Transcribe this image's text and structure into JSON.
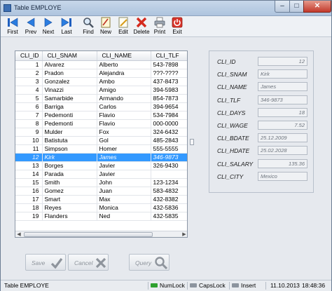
{
  "window": {
    "title": "Table EMPLOYE",
    "close_glyph": "✕",
    "min_glyph": "–",
    "max_glyph": "□"
  },
  "toolbar": [
    {
      "label": "First",
      "icon": "first-icon"
    },
    {
      "label": "Prev",
      "icon": "prev-icon"
    },
    {
      "label": "Next",
      "icon": "next-icon"
    },
    {
      "label": "Last",
      "icon": "last-icon"
    },
    {
      "label": "Find",
      "icon": "find-icon"
    },
    {
      "label": "New",
      "icon": "new-icon"
    },
    {
      "label": "Edit",
      "icon": "edit-icon"
    },
    {
      "label": "Delete",
      "icon": "delete-icon"
    },
    {
      "label": "Print",
      "icon": "print-icon"
    },
    {
      "label": "Exit",
      "icon": "exit-icon"
    }
  ],
  "grid": {
    "columns": [
      "CLI_ID",
      "CLI_SNAM",
      "CLI_NAME",
      "CLI_TLF"
    ],
    "selected_index": 11,
    "rows": [
      [
        "1",
        "Alvarez",
        "Alberto",
        "543-7898"
      ],
      [
        "2",
        "Pradon",
        "Alejandra",
        "???-????"
      ],
      [
        "3",
        "Gonzalez",
        "Ambo",
        "437-8473"
      ],
      [
        "4",
        "Vinazzi",
        "Amigo",
        "394-5983"
      ],
      [
        "5",
        "Samarbide",
        "Armando",
        "854-7873"
      ],
      [
        "6",
        "Barriga",
        "Carlos",
        "394-9654"
      ],
      [
        "7",
        "Pedemonti",
        "Flavio",
        "534-7984"
      ],
      [
        "8",
        "Pedemonti",
        "Flavio",
        "000-0000"
      ],
      [
        "9",
        "Mulder",
        "Fox",
        "324-6432"
      ],
      [
        "10",
        "Batistuta",
        "Gol",
        "485-2843"
      ],
      [
        "11",
        "Simpson",
        "Homer",
        "555-5555"
      ],
      [
        "12",
        "Kirk",
        "James",
        "346-9873"
      ],
      [
        "13",
        "Borges",
        "Javier",
        "326-9430"
      ],
      [
        "14",
        "Parada",
        "Javier",
        ""
      ],
      [
        "15",
        "Smith",
        "John",
        "123-1234"
      ],
      [
        "16",
        "Gomez",
        "Juan",
        "583-4832"
      ],
      [
        "17",
        "Smart",
        "Max",
        "432-8382"
      ],
      [
        "18",
        "Reyes",
        "Monica",
        "432-5836"
      ],
      [
        "19",
        "Flanders",
        "Ned",
        "432-5835"
      ]
    ]
  },
  "detail": [
    {
      "label": "CLI_ID",
      "value": "12",
      "align": "right"
    },
    {
      "label": "CLI_SNAM",
      "value": "Kirk",
      "align": "left"
    },
    {
      "label": "CLI_NAME",
      "value": "James",
      "align": "left"
    },
    {
      "label": "CLI_TLF",
      "value": "346-9873",
      "align": "left"
    },
    {
      "label": "CLI_DAYS",
      "value": "18",
      "align": "right"
    },
    {
      "label": "CLI_WAGE",
      "value": "7.52",
      "align": "right"
    },
    {
      "label": "CLI_BDATE",
      "value": "25.12.2009",
      "align": "left"
    },
    {
      "label": "CLI_HDATE",
      "value": "25.02.2028",
      "align": "left"
    },
    {
      "label": "CLI_SALARY",
      "value": "135.36",
      "align": "right"
    },
    {
      "label": "CLI_CITY",
      "value": "Mexico",
      "align": "left"
    }
  ],
  "buttons": {
    "save": "Save",
    "cancel": "Cancel",
    "query": "Query"
  },
  "status": {
    "title": "Table EMPLOYE",
    "numlock": "NumLock",
    "capslock": "CapsLock",
    "insert": "Insert",
    "date": "11.10.2013",
    "time": "18:48:36"
  },
  "colors": {
    "selection": "#3399ff",
    "numlock_on": "#2fa12f",
    "indicator_off": "#8c949e"
  }
}
